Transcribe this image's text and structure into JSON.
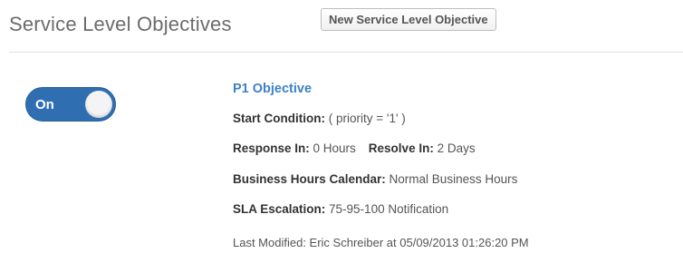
{
  "header": {
    "title": "Service Level Objectives",
    "new_button_label": "New Service Level Objective"
  },
  "toggle": {
    "label": "On",
    "state": "on",
    "color": "#2f6fb1"
  },
  "objective": {
    "name": "P1 Objective",
    "start_condition_label": "Start Condition:",
    "start_condition_value": " ( priority = '1' )",
    "response_label": "Response In:",
    "response_value": " 0 Hours",
    "resolve_label": "Resolve In:",
    "resolve_value": " 2 Days",
    "calendar_label": "Business Hours Calendar:",
    "calendar_value": " Normal Business Hours",
    "escalation_label": "SLA Escalation:",
    "escalation_value": " 75-95-100 Notification",
    "last_modified": "Last Modified: Eric Schreiber at 05/09/2013 01:26:20 PM"
  }
}
